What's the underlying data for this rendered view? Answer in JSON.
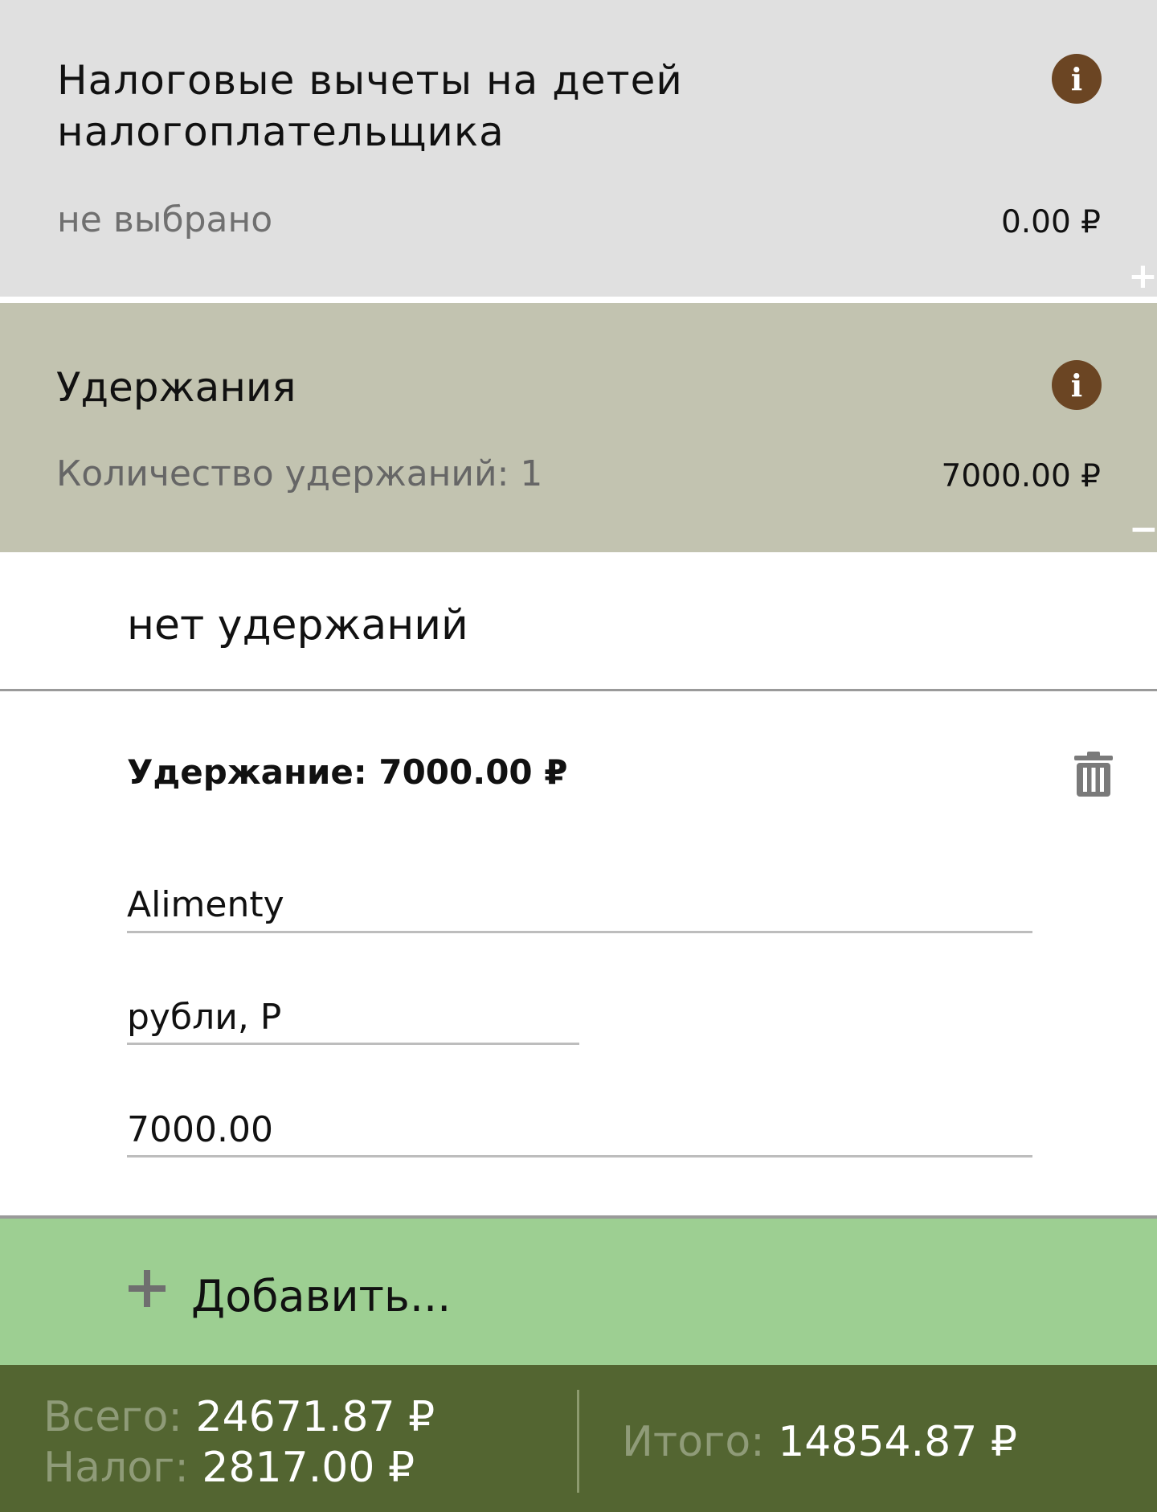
{
  "children_deductions": {
    "title": "Налоговые вычеты на детей налогоплательщика",
    "status": "не выбрано",
    "amount": "0.00 ₽",
    "toggle": "+"
  },
  "holdings": {
    "title": "Удержания",
    "count_text": "Количество удержаний: 1",
    "amount": "7000.00 ₽",
    "toggle": "−",
    "no_holdings_label": "нет удержаний",
    "item": {
      "title": "Удержание: 7000.00 ₽",
      "name": "Alimenty",
      "currency": "рубли, Р",
      "amount": "7000.00"
    }
  },
  "add_button": {
    "label": "Добавить..."
  },
  "footer": {
    "total_label": "Всего:",
    "total_value": "24671.87 ₽",
    "tax_label": "Налог:",
    "tax_value": "2817.00 ₽",
    "result_label": "Итого:",
    "result_value": "14854.87 ₽"
  },
  "icons": {
    "info": "info-icon",
    "trash": "trash-icon",
    "plus": "plus-icon"
  },
  "colors": {
    "info_icon": "#6b4523",
    "section_gray": "#e0e0e0",
    "section_olive": "#c2c3b0",
    "add_green": "#9dcf92",
    "footer_green": "#536531"
  }
}
